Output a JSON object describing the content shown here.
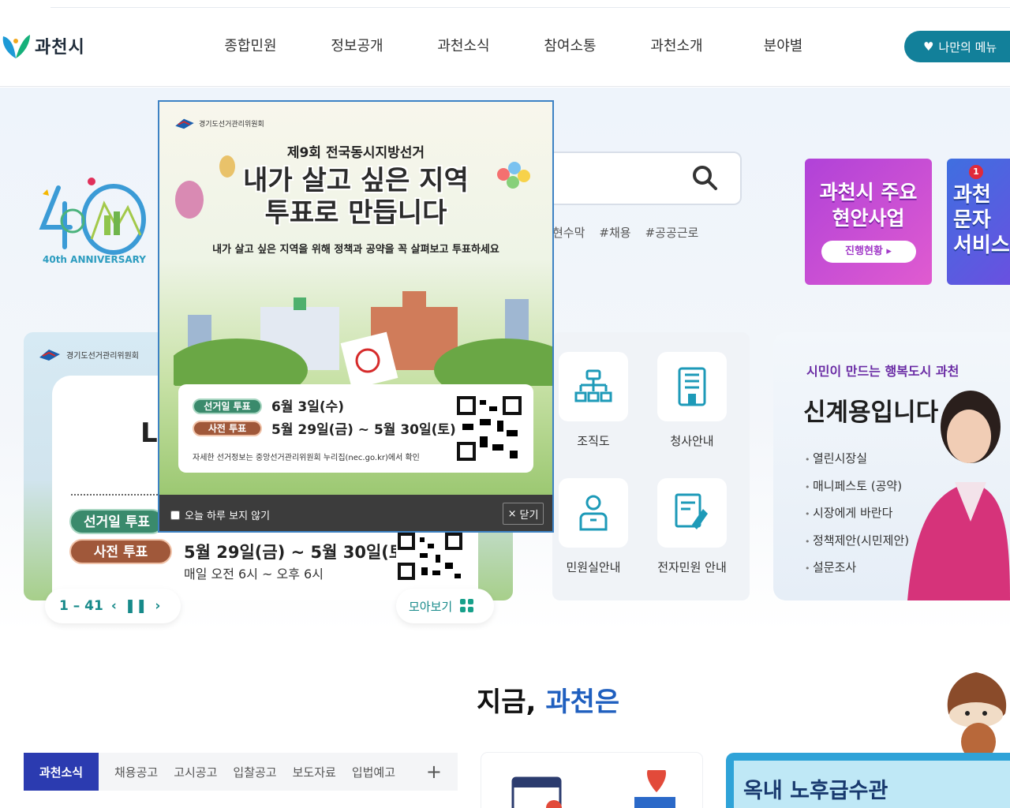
{
  "header": {
    "logo_name": "과천시",
    "nav": [
      "종합민원",
      "정보공개",
      "과천소식",
      "참여소통",
      "과천소개",
      "분야별"
    ],
    "my_menu": "나만의 메뉴"
  },
  "hero": {
    "anniversary": "40th ANNIVERSARY",
    "search_tags": [
      "현수막",
      "#채용",
      "#공공근로"
    ],
    "promo1": {
      "title_line1": "과천시 주요",
      "title_line2": "현안사업",
      "button": "진행현황"
    },
    "promo2": {
      "badge": "1",
      "title_line1": "과천",
      "title_line2": "문자",
      "title_line3": "서비스"
    }
  },
  "slider": {
    "org": "경기도선거관리위원회",
    "heading_fragment": "L",
    "pill1": "선거일 투표",
    "pill2": "사전 투표",
    "date": "5월 29일(금) ~ 5월 30일(토)",
    "time": "매일 오전 6시 ~ 오후 6시",
    "counter": "1 – 41",
    "view_all": "모아보기"
  },
  "quick_links": [
    "조직도",
    "청사안내",
    "민원실안내",
    "전자민원 안내"
  ],
  "mayor": {
    "slogan": "시민이 만드는 행복도시 과천",
    "name": "신계용입니다",
    "links": [
      "열린시장실",
      "매니페스토 (공약)",
      "시장에게 바란다",
      "정책제안(시민제안)",
      "설문조사"
    ]
  },
  "section": {
    "title_prefix": "지금,",
    "title_highlight": "과천은",
    "tabs": [
      "과천소식",
      "채용공고",
      "고시공고",
      "입찰공고",
      "보도자료",
      "입법예고"
    ],
    "plus": "+",
    "notice_text": "옥내 노후급수관"
  },
  "popup": {
    "org": "경기도선거관리위원회",
    "subtitle": "제9회 전국동시지방선거",
    "headline_line1": "내가 살고 싶은 지역",
    "headline_line2": "투표로 만듭니다",
    "description": "내가 살고 싶은 지역을 위해 정책과 공약을 꼭 살펴보고 투표하세요",
    "pill1": "선거일 투표",
    "pill2": "사전 투표",
    "date1": "6월 3일(수)",
    "date2": "5월 29일(금) ~ 5월 30일(토)",
    "info": "자세한 선거정보는 중앙선거관리위원회 누리집(nec.go.kr)에서 확인",
    "dont_show_today": "오늘 하루 보지 않기",
    "close": "닫기"
  },
  "colors": {
    "brand_teal": "#12809a",
    "tab_active": "#2b3bb0",
    "accent_blue": "#1f5fbf"
  }
}
